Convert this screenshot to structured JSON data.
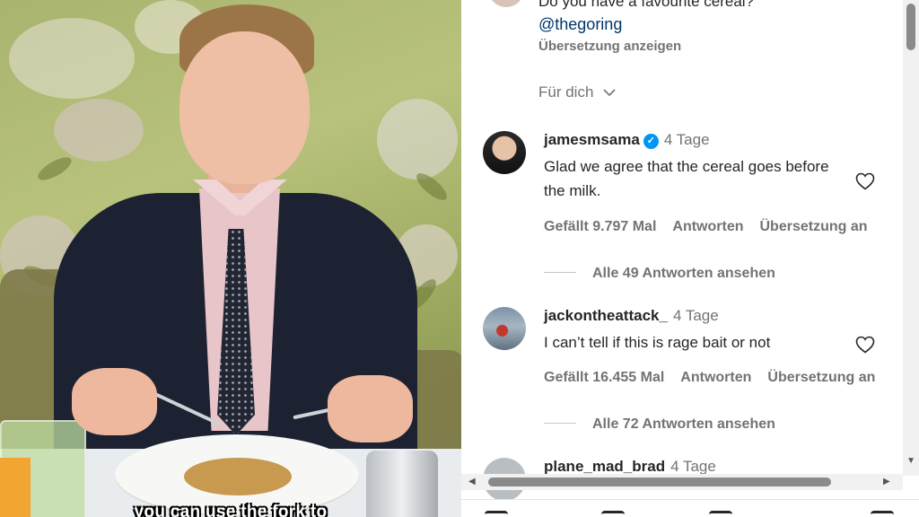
{
  "video": {
    "subtitle": "you can use the fork to"
  },
  "caption": {
    "text": "Do you have a favourite cereal?",
    "mention": "@thegoring",
    "translate": "Übersetzung anzeigen"
  },
  "sort": {
    "label": "Für dich"
  },
  "comments": [
    {
      "user": "jamesmsama",
      "verified": true,
      "time": "4 Tage",
      "text": "Glad we agree that the cereal goes before the milk.",
      "likes": "Gefällt 9.797 Mal",
      "reply": "Antworten",
      "translate": "Übersetzung an",
      "view_replies": "Alle 49 Antworten ansehen"
    },
    {
      "user": "jackontheattack_",
      "verified": false,
      "time": "4 Tage",
      "text": "I can’t tell if this is rage bait or not",
      "likes": "Gefällt 16.455 Mal",
      "reply": "Antworten",
      "translate": "Übersetzung an",
      "view_replies": "Alle 72 Antworten ansehen"
    },
    {
      "user": "plane_mad_brad",
      "time": "4 Tage"
    }
  ],
  "icons": {
    "verified": "verified-badge-icon",
    "like": "heart-icon",
    "expand": "chevron-down-icon"
  },
  "colors": {
    "verified": "#0095f6",
    "link": "#00376b",
    "secondary_text": "#737373"
  }
}
